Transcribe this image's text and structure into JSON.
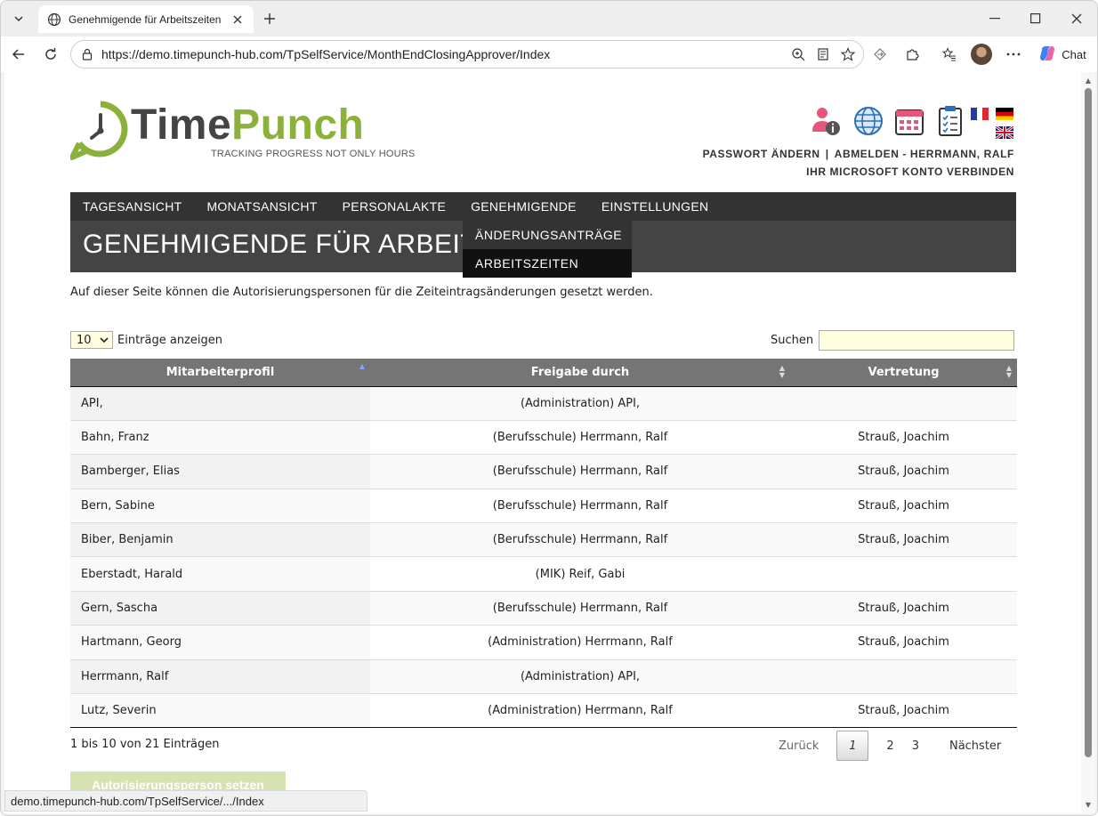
{
  "browser": {
    "tab_title": "Genehmigende für Arbeitszeiten",
    "url": "https://demo.timepunch-hub.com/TpSelfService/MonthEndClosingApprover/Index",
    "chat_label": "Chat",
    "status_url": "demo.timepunch-hub.com/TpSelfService/.../Index"
  },
  "header": {
    "logo_part1": "Time",
    "logo_part2": "Punch",
    "logo_tagline": "TRACKING PROGRESS NOT ONLY HOURS",
    "links": {
      "change_password": "PASSWORT ÄNDERN",
      "separator": "|",
      "logout": "ABMELDEN - HERRMANN, RALF",
      "connect_microsoft": "IHR MICROSOFT KONTO VERBINDEN"
    }
  },
  "menu": {
    "items": [
      "TAGESANSICHT",
      "MONATSANSICHT",
      "PERSONALAKTE",
      "GENEHMIGENDE",
      "EINSTELLUNGEN"
    ],
    "dropdown": [
      "ÄNDERUNGSANTRÄGE",
      "ARBEITSZEITEN"
    ]
  },
  "page": {
    "title": "GENEHMIGENDE FÜR ARBEITSZEITEN",
    "description": "Auf dieser Seite können die Autorisierungspersonen für die Zeiteintragsänderungen gesetzt werden."
  },
  "table_controls": {
    "page_length": "10",
    "length_label": "Einträge anzeigen",
    "search_label": "Suchen",
    "search_value": ""
  },
  "table": {
    "columns": [
      "Mitarbeiterprofil",
      "Freigabe durch",
      "Vertretung"
    ],
    "rows": [
      [
        "API,",
        "(Administration) API,",
        ""
      ],
      [
        "Bahn, Franz",
        "(Berufsschule) Herrmann, Ralf",
        "Strauß, Joachim"
      ],
      [
        "Bamberger, Elias",
        "(Berufsschule) Herrmann, Ralf",
        "Strauß, Joachim"
      ],
      [
        "Bern, Sabine",
        "(Berufsschule) Herrmann, Ralf",
        "Strauß, Joachim"
      ],
      [
        "Biber, Benjamin",
        "(Berufsschule) Herrmann, Ralf",
        "Strauß, Joachim"
      ],
      [
        "Eberstadt, Harald",
        "(MIK) Reif, Gabi",
        ""
      ],
      [
        "Gern, Sascha",
        "(Berufsschule) Herrmann, Ralf",
        "Strauß, Joachim"
      ],
      [
        "Hartmann, Georg",
        "(Administration) Herrmann, Ralf",
        "Strauß, Joachim"
      ],
      [
        "Herrmann, Ralf",
        "(Administration) API,",
        ""
      ],
      [
        "Lutz, Severin",
        "(Administration) Herrmann, Ralf",
        "Strauß, Joachim"
      ]
    ]
  },
  "pagination": {
    "info": "1 bis 10 von 21 Einträgen",
    "prev": "Zurück",
    "pages": [
      "1",
      "2",
      "3"
    ],
    "current": "1",
    "next": "Nächster"
  },
  "actions": {
    "set_authorizer": "Autorisierungsperson setzen"
  },
  "colors": {
    "accent_green": "#8bb13b",
    "menu_bg": "#333333",
    "title_bg": "#444444",
    "table_header_bg": "#757575",
    "input_bg": "#ffffe0"
  }
}
